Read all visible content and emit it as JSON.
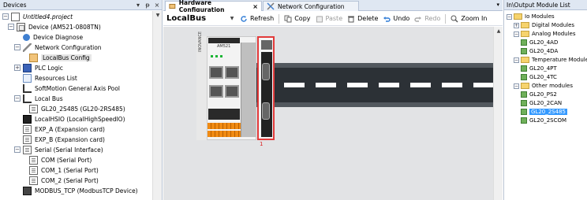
{
  "devices_panel": {
    "title": "Devices",
    "header_buttons": [
      "▾",
      "ᵽ",
      "×"
    ],
    "tree": [
      {
        "label": "Untitled4.project",
        "icon": "project-icon",
        "expander": "minus"
      },
      {
        "label": "Device (AM521-0808TN)",
        "icon": "device-icon",
        "expander": "minus"
      },
      {
        "label": "Device Diagnose",
        "icon": "diagnose-icon",
        "expander": ""
      },
      {
        "label": "Network Configuration",
        "icon": "network-icon",
        "expander": "minus"
      },
      {
        "label": "LocalBus Config",
        "icon": "localbus-icon",
        "expander": ""
      },
      {
        "label": "PLC Logic",
        "icon": "plc-logic-icon",
        "expander": "plus"
      },
      {
        "label": "Resources List",
        "icon": "list-icon",
        "expander": ""
      },
      {
        "label": "SoftMotion General Axis Pool",
        "icon": "axis-icon",
        "expander": ""
      },
      {
        "label": "Local Bus",
        "icon": "bus-icon",
        "expander": "minus"
      },
      {
        "label": "GL20_2S485 (GL20-2RS485)",
        "icon": "bus-icon",
        "expander": ""
      },
      {
        "label": "LocalHSIO (LocalHighSpeedIO)",
        "icon": "chip-icon",
        "expander": ""
      },
      {
        "label": "EXP_A (Expansion card)",
        "icon": "card-icon",
        "expander": ""
      },
      {
        "label": "EXP_B (Expansion card)",
        "icon": "card-icon",
        "expander": ""
      },
      {
        "label": "Serial (Serial Interface)",
        "icon": "card-icon",
        "expander": "minus"
      },
      {
        "label": "COM (Serial Port)",
        "icon": "card-icon",
        "expander": ""
      },
      {
        "label": "COM_1 (Serial Port)",
        "icon": "card-icon",
        "expander": ""
      },
      {
        "label": "COM_2 (Serial Port)",
        "icon": "card-icon",
        "expander": ""
      },
      {
        "label": "MODBUS_TCP (ModbusTCP Device)",
        "icon": "modbus-icon",
        "expander": ""
      }
    ]
  },
  "editor": {
    "tabs": [
      {
        "label": "Hardware Configuration",
        "close": "×",
        "active": true
      },
      {
        "label": "Network Configuration",
        "close": "",
        "active": false
      }
    ],
    "tab_menu": "▾",
    "toolbar": {
      "bus_label": "LocalBus",
      "refresh": "Refresh",
      "copy": "Copy",
      "paste": "Paste",
      "delete": "Delete",
      "undo": "Undo",
      "redo": "Redo",
      "zoom": "Zoom In"
    },
    "module_number": "1",
    "plc_model": "AM521",
    "plc_brand": "INOVANCE"
  },
  "io_panel": {
    "title": "In\\Output Module List",
    "tree": [
      {
        "label": "Io Modules",
        "type": "folder",
        "expander": "minus",
        "indent": 0
      },
      {
        "label": "Digital Modules",
        "type": "folder",
        "expander": "plus",
        "indent": 1
      },
      {
        "label": "Analog Modules",
        "type": "folder",
        "expander": "minus",
        "indent": 1
      },
      {
        "label": "GL20_4AD",
        "type": "module",
        "expander": "",
        "indent": 2
      },
      {
        "label": "GL20_4DA",
        "type": "module",
        "expander": "",
        "indent": 2
      },
      {
        "label": "Temperature Modules",
        "type": "folder",
        "expander": "minus",
        "indent": 1
      },
      {
        "label": "GL20_4PT",
        "type": "module",
        "expander": "",
        "indent": 2
      },
      {
        "label": "GL20_4TC",
        "type": "module",
        "expander": "",
        "indent": 2
      },
      {
        "label": "Other modules",
        "type": "folder",
        "expander": "minus",
        "indent": 1
      },
      {
        "label": "GL20_PS2",
        "type": "module",
        "expander": "",
        "indent": 2
      },
      {
        "label": "GL20_2CAN",
        "type": "module",
        "expander": "",
        "indent": 2
      },
      {
        "label": "GL20_2S485",
        "type": "module",
        "expander": "",
        "indent": 2,
        "selected": true
      },
      {
        "label": "GL20_2SCOM",
        "type": "module",
        "expander": "",
        "indent": 2
      }
    ]
  },
  "colors": {
    "panel_header": "#dfe7f2",
    "selection": "#3399ff",
    "module_highlight": "#e23a3a",
    "canvas": "#e2e3e5",
    "rail": "#2c3136"
  }
}
